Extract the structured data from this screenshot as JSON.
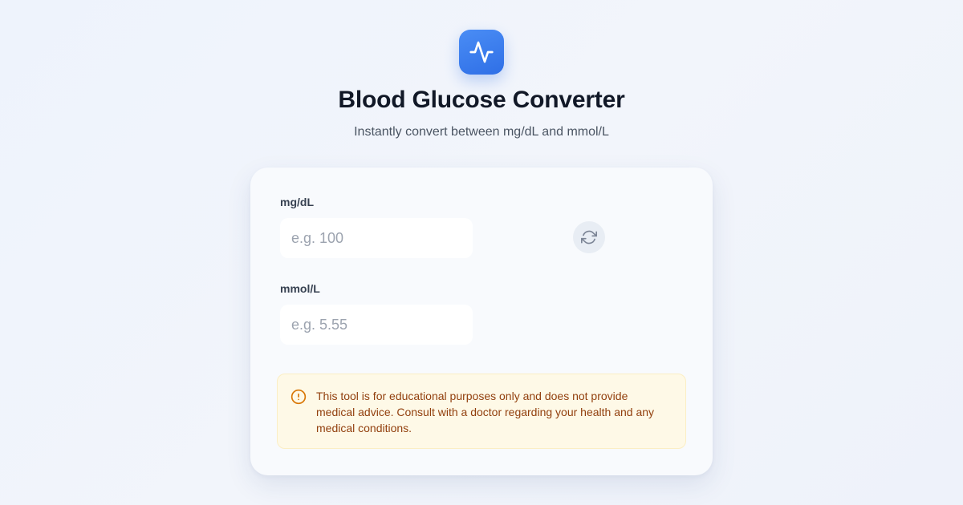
{
  "header": {
    "icon": "activity-pulse-icon",
    "title": "Blood Glucose Converter",
    "subtitle": "Instantly convert between mg/dL and mmol/L"
  },
  "converter": {
    "mgdl": {
      "label": "mg/dL",
      "value": "",
      "placeholder": "e.g. 100"
    },
    "mmol": {
      "label": "mmol/L",
      "value": "",
      "placeholder": "e.g. 5.55"
    },
    "swap_icon": "refresh-icon"
  },
  "disclaimer": {
    "icon": "alert-circle-icon",
    "text": "This tool is for educational purposes only and does not provide medical advice. Consult with a doctor regarding your health and any medical conditions."
  },
  "colors": {
    "accent": "#3b82f6",
    "warning_bg": "#fef9e7",
    "warning_text": "#92400e",
    "warning_icon": "#d97706"
  }
}
